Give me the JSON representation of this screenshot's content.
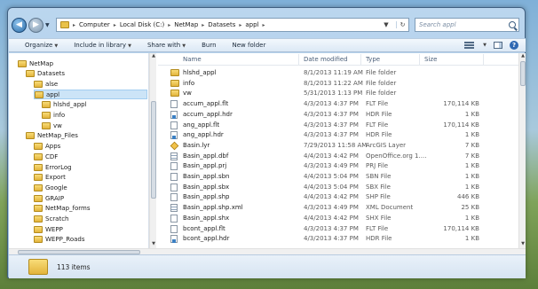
{
  "address": {
    "crumbs": [
      "Computer",
      "Local Disk (C:)",
      "NetMap",
      "Datasets",
      "appl"
    ],
    "search_placeholder": "Search appl"
  },
  "toolbar": {
    "organize": "Organize",
    "include": "Include in library",
    "share": "Share with",
    "burn": "Burn",
    "new_folder": "New folder"
  },
  "nav": {
    "items": [
      {
        "label": "NetMap",
        "indent": 0
      },
      {
        "label": "Datasets",
        "indent": 1
      },
      {
        "label": "alse",
        "indent": 2
      },
      {
        "label": "appl",
        "indent": 2,
        "selected": true
      },
      {
        "label": "hlshd_appl",
        "indent": 3
      },
      {
        "label": "info",
        "indent": 3
      },
      {
        "label": "vw",
        "indent": 3
      },
      {
        "label": "NetMap_Files",
        "indent": 1
      },
      {
        "label": "Apps",
        "indent": 2
      },
      {
        "label": "CDF",
        "indent": 2
      },
      {
        "label": "ErrorLog",
        "indent": 2
      },
      {
        "label": "Export",
        "indent": 2
      },
      {
        "label": "Google",
        "indent": 2
      },
      {
        "label": "GRAIP",
        "indent": 2
      },
      {
        "label": "NetMap_forms",
        "indent": 2
      },
      {
        "label": "Scratch",
        "indent": 2
      },
      {
        "label": "WEPP",
        "indent": 2
      },
      {
        "label": "WEPP_Roads",
        "indent": 2
      }
    ]
  },
  "columns": {
    "name": "Name",
    "date": "Date modified",
    "type": "Type",
    "size": "Size"
  },
  "files": [
    {
      "icon": "folder",
      "name": "hlshd_appl",
      "date": "8/1/2013 11:19 AM",
      "type": "File folder",
      "size": ""
    },
    {
      "icon": "folder",
      "name": "info",
      "date": "8/1/2013 11:22 AM",
      "type": "File folder",
      "size": ""
    },
    {
      "icon": "folder",
      "name": "vw",
      "date": "5/31/2013 1:13 PM",
      "type": "File folder",
      "size": ""
    },
    {
      "icon": "doc",
      "name": "accum_appl.flt",
      "date": "4/3/2013 4:37 PM",
      "type": "FLT File",
      "size": "170,114 KB"
    },
    {
      "icon": "hdr",
      "name": "accum_appl.hdr",
      "date": "4/3/2013 4:37 PM",
      "type": "HDR File",
      "size": "1 KB"
    },
    {
      "icon": "doc",
      "name": "ang_appl.flt",
      "date": "4/3/2013 4:37 PM",
      "type": "FLT File",
      "size": "170,114 KB"
    },
    {
      "icon": "hdr",
      "name": "ang_appl.hdr",
      "date": "4/3/2013 4:37 PM",
      "type": "HDR File",
      "size": "1 KB"
    },
    {
      "icon": "lyr",
      "name": "Basin.lyr",
      "date": "7/29/2013 11:58 AM",
      "type": "ArcGIS Layer",
      "size": "7 KB"
    },
    {
      "icon": "dbf",
      "name": "Basin_appl.dbf",
      "date": "4/4/2013 4:42 PM",
      "type": "OpenOffice.org 1....",
      "size": "7 KB"
    },
    {
      "icon": "doc",
      "name": "Basin_appl.prj",
      "date": "4/3/2013 4:49 PM",
      "type": "PRJ File",
      "size": "1 KB"
    },
    {
      "icon": "doc",
      "name": "Basin_appl.sbn",
      "date": "4/4/2013 5:04 PM",
      "type": "SBN File",
      "size": "1 KB"
    },
    {
      "icon": "doc",
      "name": "Basin_appl.sbx",
      "date": "4/4/2013 5:04 PM",
      "type": "SBX File",
      "size": "1 KB"
    },
    {
      "icon": "doc",
      "name": "Basin_appl.shp",
      "date": "4/4/2013 4:42 PM",
      "type": "SHP File",
      "size": "446 KB"
    },
    {
      "icon": "dbf",
      "name": "Basin_appl.shp.xml",
      "date": "4/3/2013 4:49 PM",
      "type": "XML Document",
      "size": "25 KB"
    },
    {
      "icon": "doc",
      "name": "Basin_appl.shx",
      "date": "4/4/2013 4:42 PM",
      "type": "SHX File",
      "size": "1 KB"
    },
    {
      "icon": "doc",
      "name": "bcont_appl.flt",
      "date": "4/3/2013 4:37 PM",
      "type": "FLT File",
      "size": "170,114 KB"
    },
    {
      "icon": "hdr",
      "name": "bcont_appl.hdr",
      "date": "4/3/2013 4:37 PM",
      "type": "HDR File",
      "size": "1 KB"
    }
  ],
  "status": {
    "count": "113 items"
  }
}
